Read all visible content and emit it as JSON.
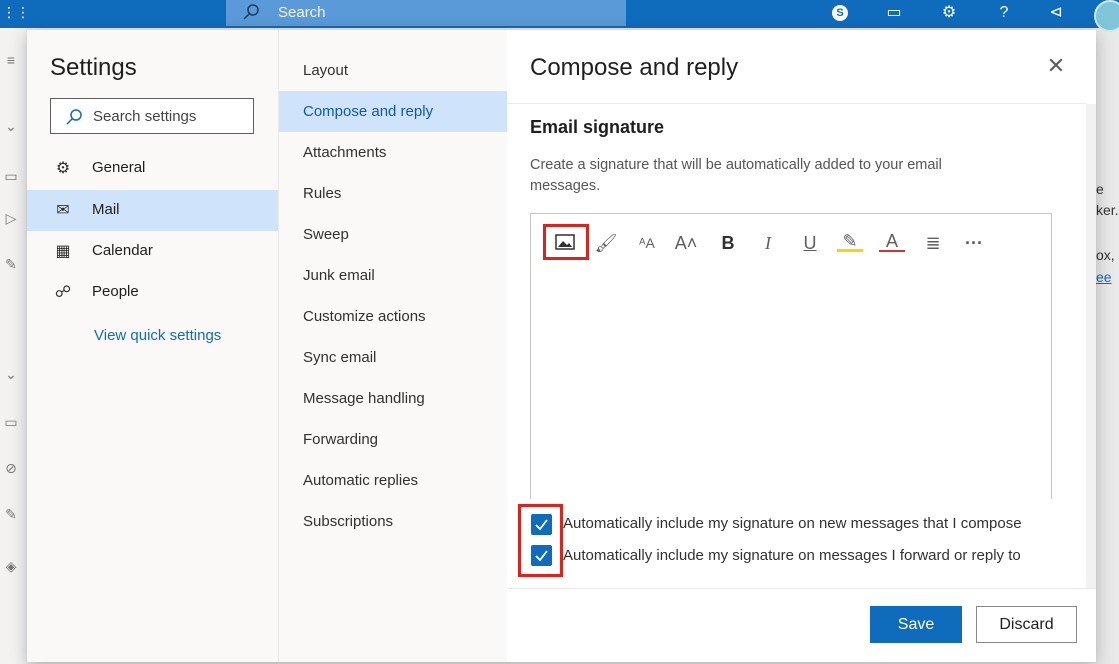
{
  "topbar": {
    "search_label": "Search",
    "icons": [
      "waffle-icon",
      "search-icon",
      "skype-icon",
      "my-day-icon",
      "gear-icon",
      "help-icon",
      "feedback-icon",
      "avatar"
    ]
  },
  "settings": {
    "title": "Settings",
    "search_placeholder": "Search settings",
    "nav": [
      {
        "label": "General",
        "icon": "gear-icon"
      },
      {
        "label": "Mail",
        "icon": "mail-icon"
      },
      {
        "label": "Calendar",
        "icon": "calendar-icon"
      },
      {
        "label": "People",
        "icon": "people-icon"
      }
    ],
    "quick_link": "View quick settings"
  },
  "mail_settings": {
    "items": [
      {
        "label": "Layout"
      },
      {
        "label": "Compose and reply"
      },
      {
        "label": "Attachments"
      },
      {
        "label": "Rules"
      },
      {
        "label": "Sweep"
      },
      {
        "label": "Junk email"
      },
      {
        "label": "Customize actions"
      },
      {
        "label": "Sync email"
      },
      {
        "label": "Message handling"
      },
      {
        "label": "Forwarding"
      },
      {
        "label": "Automatic replies"
      },
      {
        "label": "Subscriptions"
      }
    ],
    "active_item": "Compose and reply"
  },
  "compose": {
    "title": "Compose and reply",
    "section_title": "Email signature",
    "description": "Create a signature that will be automatically added to your email messages.",
    "toolbar": [
      "insert-image-icon",
      "format-painter-icon",
      "font-size-icon",
      "grow-font-icon",
      "bold-icon",
      "italic-icon",
      "underline-icon",
      "highlight-icon",
      "font-color-icon",
      "bullets-icon",
      "more-icon"
    ],
    "toolbar_glyphs": {
      "bold": "B",
      "italic": "I",
      "underline": "U",
      "font_color": "A",
      "more": "···"
    },
    "checkbox_new": {
      "label": "Automatically include my signature on new messages that I compose",
      "checked": true
    },
    "checkbox_reply": {
      "label": "Automatically include my signature on messages I forward or reply to",
      "checked": true
    },
    "save_label": "Save",
    "discard_label": "Discard"
  },
  "background": {
    "fragments": [
      "e",
      "ker.",
      "ox,",
      "ee"
    ]
  },
  "colors": {
    "accent": "#0f6cbd",
    "selected": "#cfe4fa",
    "highlight_box": "#e0221b"
  }
}
